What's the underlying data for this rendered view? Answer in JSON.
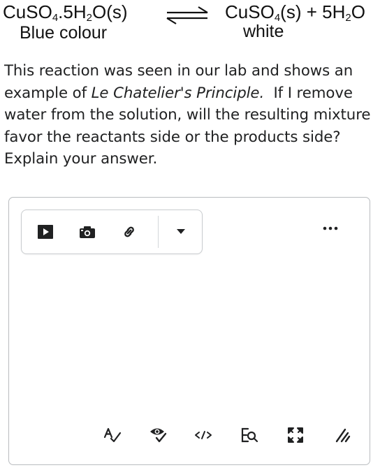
{
  "equation": {
    "left_formula": [
      "CuSO",
      "4",
      ".5H",
      "2",
      "O(s)"
    ],
    "right_formula": [
      "CuSO",
      "4",
      "(s) + 5H",
      "2",
      "O"
    ],
    "left_caption": "Blue colour",
    "right_caption": "white"
  },
  "question": {
    "part1": "This reaction was seen in our lab and shows an example of ",
    "emphasis": "Le Chatelier's Principle.",
    "part2": "  If I remove water from the solution, will the resulting mixture favor the reactants side or the products side? Explain your answer."
  },
  "editor": {
    "toolbar_icons": [
      "video-icon",
      "camera-icon",
      "link-icon",
      "dropdown-caret-icon"
    ],
    "more_icon": "more-options-icon",
    "bottom_icons": [
      "spellcheck-icon",
      "accessibility-check-icon",
      "source-code-icon",
      "find-replace-icon",
      "fullscreen-icon",
      "resize-handle-icon"
    ]
  },
  "colors": {
    "icon": "#202122",
    "border": "#b9bcbf",
    "text": "#202122"
  }
}
